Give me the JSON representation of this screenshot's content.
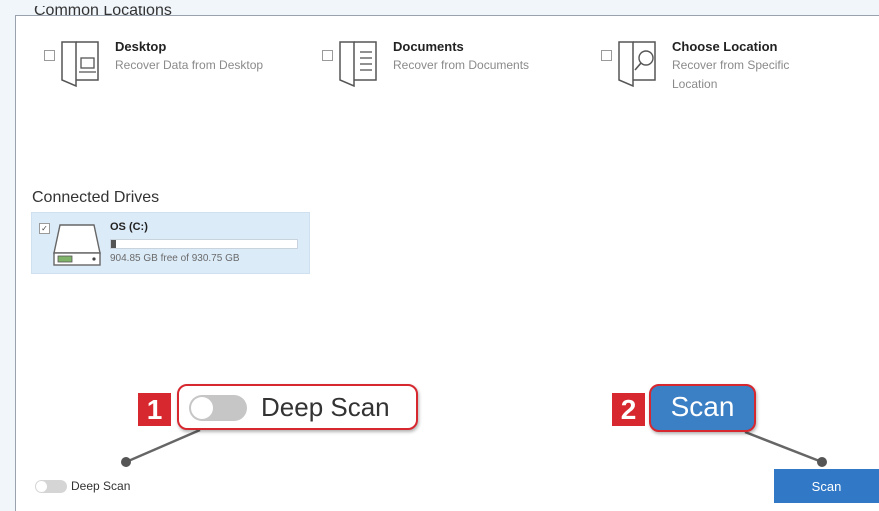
{
  "common_locations": {
    "title": "Common Locations",
    "items": [
      {
        "name": "Desktop",
        "desc": "Recover Data from Desktop",
        "icon": "desktop-folder-icon"
      },
      {
        "name": "Documents",
        "desc": "Recover from Documents",
        "icon": "documents-folder-icon"
      },
      {
        "name": "Choose Location",
        "desc": "Recover from Specific Location",
        "icon": "search-folder-icon"
      }
    ]
  },
  "connected_drives": {
    "title": "Connected Drives",
    "drive": {
      "name": "OS (C:)",
      "space": "904.85 GB free of 930.75 GB",
      "checked": "✓",
      "used_fraction": 0.028
    }
  },
  "callouts": {
    "one": {
      "number": "1",
      "label": "Deep Scan"
    },
    "two": {
      "number": "2",
      "label": "Scan"
    }
  },
  "footer": {
    "deep_scan_label": "Deep Scan",
    "scan_button": "Scan"
  },
  "colors": {
    "accent_blue": "#3178c6",
    "callout_red": "#d7272f",
    "drive_highlight": "#dcebf8"
  }
}
